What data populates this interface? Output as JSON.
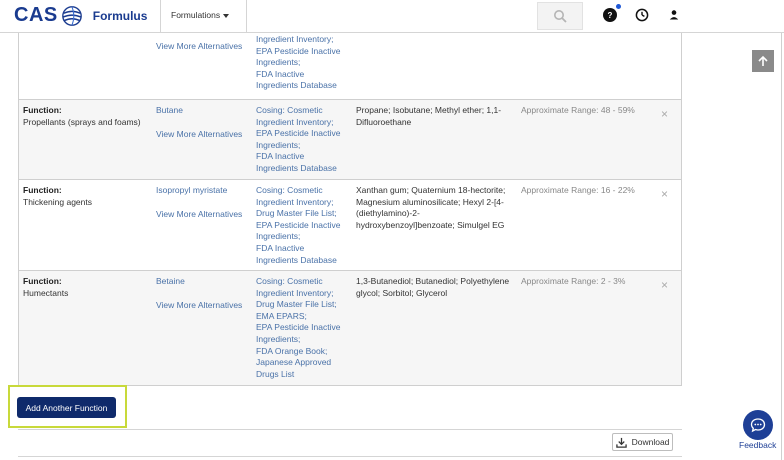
{
  "header": {
    "logo_text": "CAS",
    "product_name": "Formulus",
    "nav_dropdown_label": "Formulations",
    "help_label": "?",
    "brand_color": "#1a3b8f",
    "notification_color": "#1f58d6"
  },
  "rows_partial": {
    "ingredient_link": "View More Alternatives",
    "sources": [
      "Ingredient Inventory;",
      "EPA Pesticide Inactive",
      "Ingredients;",
      "FDA Inactive",
      "Ingredients Database"
    ]
  },
  "rows": [
    {
      "function_label": "Function:",
      "function_value": "Propellants (sprays and foams)",
      "ingredient": "Butane",
      "more_link": "View More Alternatives",
      "sources": [
        "Cosing: Cosmetic",
        "Ingredient Inventory;",
        "EPA Pesticide Inactive",
        "Ingredients;",
        "FDA Inactive",
        "Ingredients Database"
      ],
      "alternatives": [
        "Propane; Isobutane; Methyl ether; 1,1-",
        "Difluoroethane"
      ],
      "range": "Approximate Range: 48 - 59%",
      "remove": "×"
    },
    {
      "function_label": "Function:",
      "function_value": "Thickening agents",
      "ingredient": "Isopropyl myristate",
      "more_link": "View More Alternatives",
      "sources": [
        "Cosing: Cosmetic",
        "Ingredient Inventory;",
        "Drug Master File List;",
        "EPA Pesticide Inactive",
        "Ingredients;",
        "FDA Inactive",
        "Ingredients Database"
      ],
      "alternatives": [
        "Xanthan gum; Quaternium 18-hectorite;",
        "Magnesium aluminosilicate; Hexyl 2-[4-",
        "(diethylamino)-2-",
        "hydroxybenzoyl]benzoate; Simulgel EG"
      ],
      "range": "Approximate Range: 16 - 22%",
      "remove": "×"
    },
    {
      "function_label": "Function:",
      "function_value": "Humectants",
      "ingredient": "Betaine",
      "more_link": "View More Alternatives",
      "sources": [
        "Cosing: Cosmetic",
        "Ingredient Inventory;",
        "Drug Master File List;",
        "EMA EPARS;",
        "EPA Pesticide Inactive",
        "Ingredients;",
        "FDA Orange Book;",
        "Japanese Approved",
        "Drugs List"
      ],
      "alternatives": [
        "1,3-Butanediol; Butanediol; Polyethylene",
        "glycol; Sorbitol; Glycerol"
      ],
      "range": "Approximate Range: 2 - 3%",
      "remove": "×"
    }
  ],
  "actions": {
    "add_function_label": "Add Another Function",
    "download_label": "Download",
    "feedback_label": "Feedback",
    "button_color": "#0f2a6b",
    "highlight_color": "#c8d93a"
  },
  "icons": {
    "search": "search-icon",
    "help": "help-icon",
    "history": "clock-icon",
    "user": "user-icon",
    "back_to_top": "arrow-up-icon",
    "download": "download-icon",
    "feedback": "chat-icon",
    "remove": "close-icon"
  }
}
